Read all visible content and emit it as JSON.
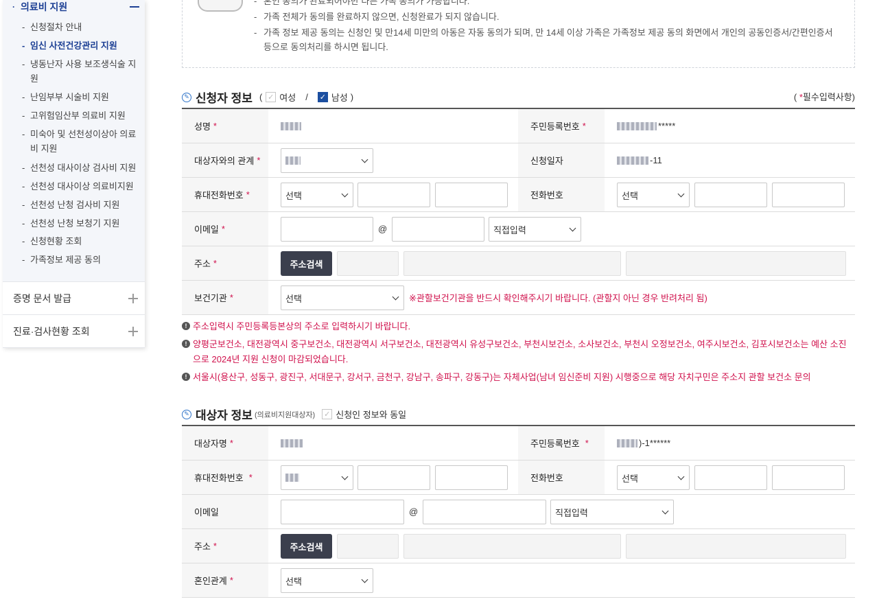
{
  "sidebar": {
    "open_section": {
      "label": "의료비 지원"
    },
    "sub_items": [
      {
        "label": "신청절차 안내",
        "active": false
      },
      {
        "label": "임신 사전건강관리 지원",
        "active": true
      },
      {
        "label": "냉동난자 사용 보조생식술 지원",
        "active": false
      },
      {
        "label": "난임부부 시술비 지원",
        "active": false
      },
      {
        "label": "고위험임산부 의료비 지원",
        "active": false
      },
      {
        "label": "미숙아 및 선천성이상아 의료비 지원",
        "active": false
      },
      {
        "label": "선천성 대사이상 검사비 지원",
        "active": false
      },
      {
        "label": "선천성 대사이상 의료비지원",
        "active": false
      },
      {
        "label": "선천성 난청 검사비 지원",
        "active": false
      },
      {
        "label": "선천성 난청 보청기 지원",
        "active": false
      },
      {
        "label": "신청현황 조회",
        "active": false
      },
      {
        "label": "가족정보 제공 동의",
        "active": false
      }
    ],
    "closed_sections": [
      {
        "label": "증명 문서 발급"
      },
      {
        "label": "진료·검사현황 조회"
      }
    ]
  },
  "notice": {
    "items": [
      "혼인 동의가 완료되어야만 다른 가족 동의가 가능합니다.",
      "가족 전체가 동의를 완료하지 않으면, 신청완료가 되지 않습니다.",
      "가족 정보 제공 동의는 신청인 및 만14세 미만의 아동은 자동 동의가 되며, 만 14세 이상 가족은 가족정보 제공 동의 화면에서 개인의 공동인증서/간편인증서 등으로 동의처리를 하시면 됩니다."
    ]
  },
  "applicant": {
    "title": "신청자 정보",
    "gender_female": "여성",
    "gender_male": "남성",
    "gender_divider": "/",
    "gender_open": "(",
    "gender_close": ")",
    "required_note_open": "(",
    "required_note": "필수입력사항)",
    "required_star": "*",
    "name_label": "성명",
    "rrn_label": "주민등록번호",
    "rrn_value": "*****",
    "relation_label": "대상자와의 관계",
    "apply_date_label": "신청일자",
    "apply_date_value": "-11",
    "mobile_label": "휴대전화번호",
    "mobile_select": "선택",
    "phone_label": "전화번호",
    "phone_select": "선택",
    "email_label": "이메일",
    "email_at": "@",
    "email_domain_select": "직접입력",
    "address_label": "주소",
    "address_button": "주소검색",
    "health_center_label": "보건기관",
    "health_center_select": "선택",
    "health_center_note": "※관할보건기관을 반드시 확인해주시기 바랍니다. (관할지 아닌 경우 반려처리 됨)"
  },
  "warnings": [
    "주소입력시 주민등록등본상의 주소로 입력하시기 바랍니다.",
    "양평군보건소, 대전광역시 중구보건소, 대전광역시 서구보건소, 대전광역시 유성구보건소, 부천시보건소, 소사보건소, 부천시 오정보건소, 여주시보건소, 김포시보건소는 예산 소진으로 2024년 지원 신청이 마감되었습니다.",
    "서울시(용산구, 성동구, 광진구, 서대문구, 강서구, 금천구, 강남구, 송파구, 강동구)는 자체사업(남녀 임신준비 지원) 시행중으로 해당 자치구민은 주소지 관할 보건소 문의"
  ],
  "target": {
    "title": "대상자 정보",
    "subtitle": "(의료비지원대상자)",
    "same_as_applicant": "신청인 정보와 동일",
    "name_label": "대상자명",
    "rrn_label": "주민등록번호",
    "rrn_value": ")-1******",
    "mobile_label": "휴대전화번호",
    "phone_label": "전화번호",
    "phone_select": "선택",
    "email_label": "이메일",
    "email_at": "@",
    "email_domain_select": "직접입력",
    "address_label": "주소",
    "address_button": "주소검색",
    "marriage_label": "혼인관계",
    "marriage_select": "선택"
  },
  "colors": {
    "accent": "#1c3f94",
    "required": "#d0114c",
    "button": "#3b3f4d"
  }
}
